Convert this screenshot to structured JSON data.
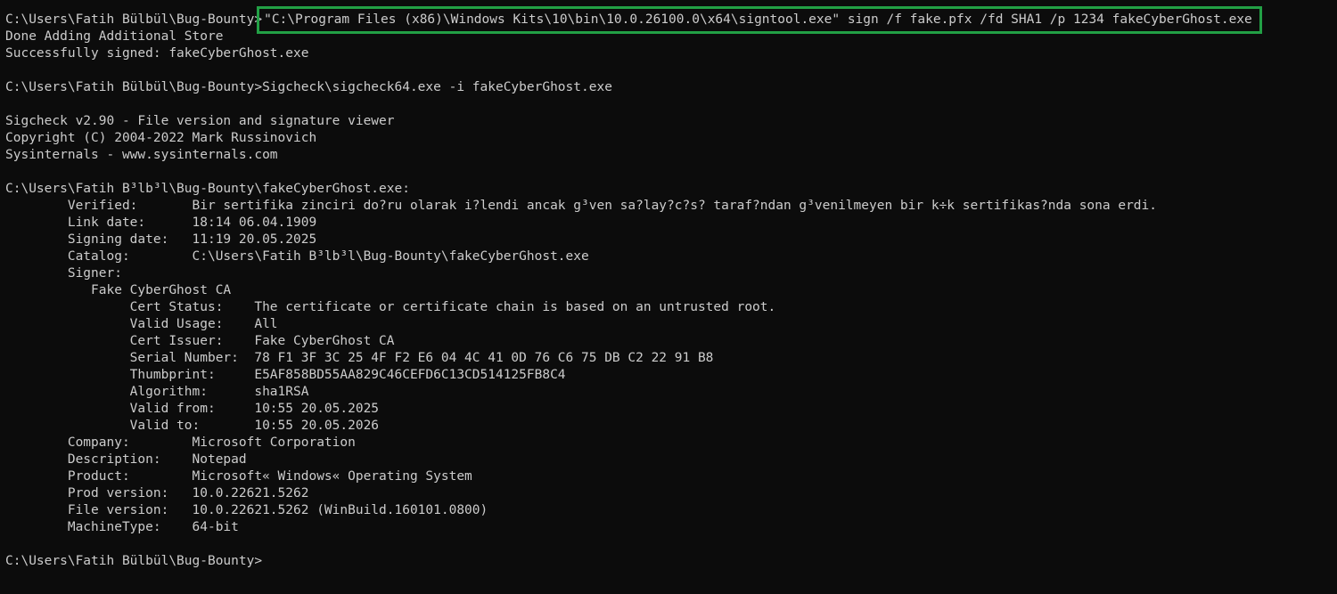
{
  "lines": [
    {
      "prompt": "C:\\Users\\Fatih Bülbül\\Bug-Bounty>",
      "cmd": "\"C:\\Program Files (x86)\\Windows Kits\\10\\bin\\10.0.26100.0\\x64\\signtool.exe\" sign /f fake.pfx /fd SHA1 /p 1234 fakeCyberGhost.exe"
    },
    {
      "text": "Done Adding Additional Store"
    },
    {
      "text": "Successfully signed: fakeCyberGhost.exe"
    },
    {
      "text": ""
    },
    {
      "text": "C:\\Users\\Fatih Bülbül\\Bug-Bounty>Sigcheck\\sigcheck64.exe -i fakeCyberGhost.exe"
    },
    {
      "text": ""
    },
    {
      "text": "Sigcheck v2.90 - File version and signature viewer"
    },
    {
      "text": "Copyright (C) 2004-2022 Mark Russinovich"
    },
    {
      "text": "Sysinternals - www.sysinternals.com"
    },
    {
      "text": ""
    },
    {
      "text": "C:\\Users\\Fatih B³lb³l\\Bug-Bounty\\fakeCyberGhost.exe:"
    },
    {
      "text": "        Verified:       Bir sertifika zinciri do?ru olarak i?lendi ancak g³ven sa?lay?c?s? taraf?ndan g³venilmeyen bir k÷k sertifikas?nda sona erdi."
    },
    {
      "text": "        Link date:      18:14 06.04.1909"
    },
    {
      "text": "        Signing date:   11:19 20.05.2025"
    },
    {
      "text": "        Catalog:        C:\\Users\\Fatih B³lb³l\\Bug-Bounty\\fakeCyberGhost.exe"
    },
    {
      "text": "        Signer:"
    },
    {
      "text": "           Fake CyberGhost CA"
    },
    {
      "text": "                Cert Status:    The certificate or certificate chain is based on an untrusted root."
    },
    {
      "text": "                Valid Usage:    All"
    },
    {
      "text": "                Cert Issuer:    Fake CyberGhost CA"
    },
    {
      "text": "                Serial Number:  78 F1 3F 3C 25 4F F2 E6 04 4C 41 0D 76 C6 75 DB C2 22 91 B8"
    },
    {
      "text": "                Thumbprint:     E5AF858BD55AA829C46CEFD6C13CD514125FB8C4"
    },
    {
      "text": "                Algorithm:      sha1RSA"
    },
    {
      "text": "                Valid from:     10:55 20.05.2025"
    },
    {
      "text": "                Valid to:       10:55 20.05.2026"
    },
    {
      "text": "        Company:        Microsoft Corporation"
    },
    {
      "text": "        Description:    Notepad"
    },
    {
      "text": "        Product:        Microsoft« Windows« Operating System"
    },
    {
      "text": "        Prod version:   10.0.22621.5262"
    },
    {
      "text": "        File version:   10.0.22621.5262 (WinBuild.160101.0800)"
    },
    {
      "text": "        MachineType:    64-bit"
    },
    {
      "text": ""
    },
    {
      "text": "C:\\Users\\Fatih Bülbül\\Bug-Bounty>"
    }
  ],
  "colors": {
    "background": "#0c0c0c",
    "foreground": "#cccccc",
    "highlight_border": "#22a045"
  }
}
